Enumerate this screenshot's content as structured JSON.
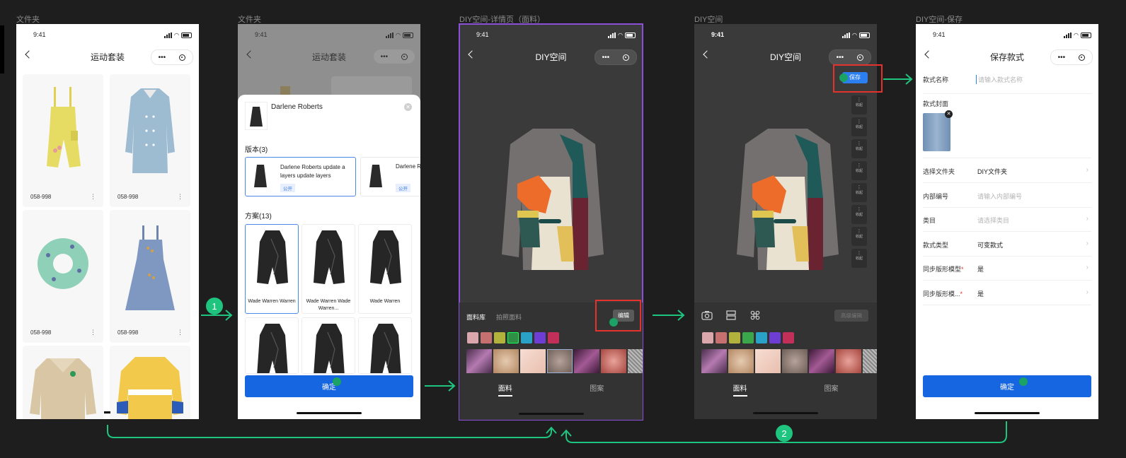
{
  "screen_labels": [
    "文件夹",
    "文件夹",
    "DIY空间-详情页（面料）",
    "DIY空间",
    "DIY空间-保存"
  ],
  "status_time": "9:41",
  "s1": {
    "title": "运动套装",
    "codes": [
      "058-998",
      "058-998",
      "058-998",
      "058-998"
    ],
    "more_glyph": "⋮"
  },
  "s2": {
    "title": "运动套装",
    "sheet_name": "Darlene Roberts",
    "versions_header": "版本(3)",
    "version1_desc": "Darlene Roberts update a layers update layers",
    "version1_tag": "公开",
    "version2_desc": "Darlene R",
    "version2_tag": "公开",
    "plans_header": "方案(13)",
    "plan_names": [
      "Wade Warren Warren",
      "Wade Warren Wade Warren...",
      "Wade Warren"
    ],
    "confirm": "确定"
  },
  "s3": {
    "title": "DIY空间",
    "tab_lib": "面料库",
    "tab_photo": "拍照面料",
    "edit": "编辑",
    "tab_fabric": "面料",
    "tab_pattern": "图案"
  },
  "s4": {
    "title": "DIY空间",
    "save": "保存",
    "collapse": "收起",
    "advanced": "高级编辑",
    "tab_fabric": "面料",
    "tab_pattern": "图案"
  },
  "s5": {
    "title": "保存款式",
    "name_label": "款式名称",
    "name_placeholder": "请输入款式名称",
    "cover_label": "款式封面",
    "rows": [
      {
        "k": "选择文件夹",
        "v": "DIY文件夹",
        "placeholder": false,
        "req": ""
      },
      {
        "k": "内部编号",
        "v": "请输入内部编号",
        "placeholder": true,
        "req": ""
      },
      {
        "k": "类目",
        "v": "请选择类目",
        "placeholder": true,
        "req": ""
      },
      {
        "k": "款式类型",
        "v": "可变款式",
        "placeholder": false,
        "req": ""
      },
      {
        "k": "同步版形模型",
        "v": "是",
        "placeholder": false,
        "req": "*"
      },
      {
        "k": "同步版形模...",
        "v": "是",
        "placeholder": false,
        "req": "*"
      }
    ],
    "confirm": "确定"
  },
  "flow": {
    "step1": "1",
    "step2": "2"
  },
  "colors": {
    "flow_green": "#1fc57f",
    "primary_blue": "#1665e1",
    "highlight_red": "#e5322d",
    "selected_purple": "#8b4fd8",
    "swatches": [
      "#d9a7ac",
      "#c77070",
      "#b3b23d",
      "#2f8f45",
      "#2aa2c8",
      "#6e3ed4",
      "#c2305a"
    ]
  },
  "icons": [
    "back-chevron-icon",
    "more-dots-icon",
    "target-icon",
    "camera-icon",
    "layout-icon",
    "command-icon",
    "close-icon"
  ]
}
